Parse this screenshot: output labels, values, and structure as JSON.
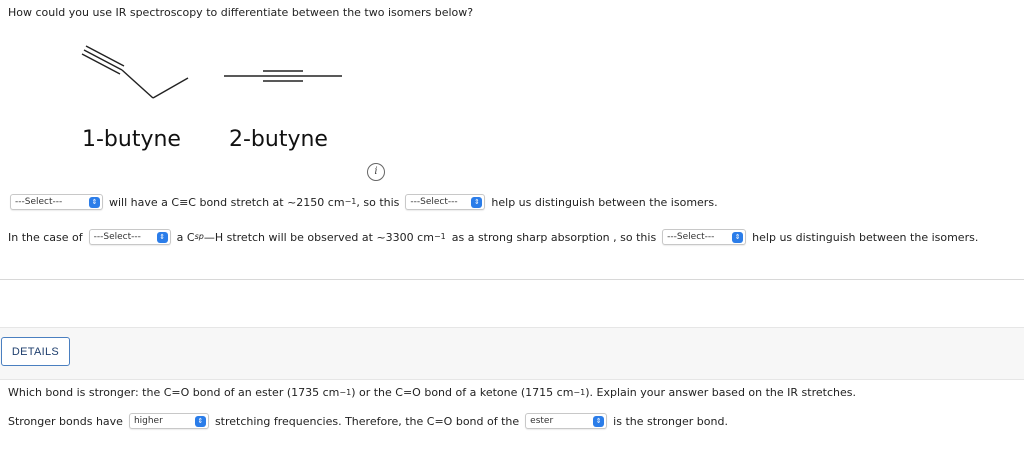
{
  "question": "How could you use IR spectroscopy to differentiate between the two isomers below?",
  "molecules": {
    "name1": "1-butyne",
    "name2": "2-butyne"
  },
  "info_icon_label": "i",
  "line1": {
    "select1": "---Select---",
    "text1": "will have a C≡C bond stretch at ~2150 cm",
    "sup1": "−1",
    "text2": ", so this",
    "select2": "---Select---",
    "text3": "help us distinguish between the isomers."
  },
  "line2": {
    "prefix": "In the case of",
    "select1": "---Select---",
    "text1": "a C",
    "sub1": "sp",
    "text2": "—H stretch will be observed at ~3300 cm",
    "sup1": "−1",
    "text3": "as a strong sharp absorption , so this",
    "select2": "---Select---",
    "text4": "help us distinguish between the isomers."
  },
  "details_button": "DETAILS",
  "question2": {
    "text1": "Which bond is stronger: the C=O bond of an ester (1735 cm",
    "sup1": "−1",
    "text2": ") or the C=O bond of a ketone (1715 cm",
    "sup2": "−1",
    "text3": "). Explain your answer based on the IR stretches."
  },
  "line3": {
    "text1": "Stronger bonds have",
    "select1": "higher",
    "text2": "stretching frequencies. Therefore, the C=O bond of the",
    "select2": "ester",
    "text3": "is the stronger bond."
  },
  "colors": {
    "accent": "#2b7de9",
    "button_border": "#4a7fc0"
  },
  "icons": {
    "select_arrow": "chevron-updown-icon",
    "info": "info-icon"
  }
}
